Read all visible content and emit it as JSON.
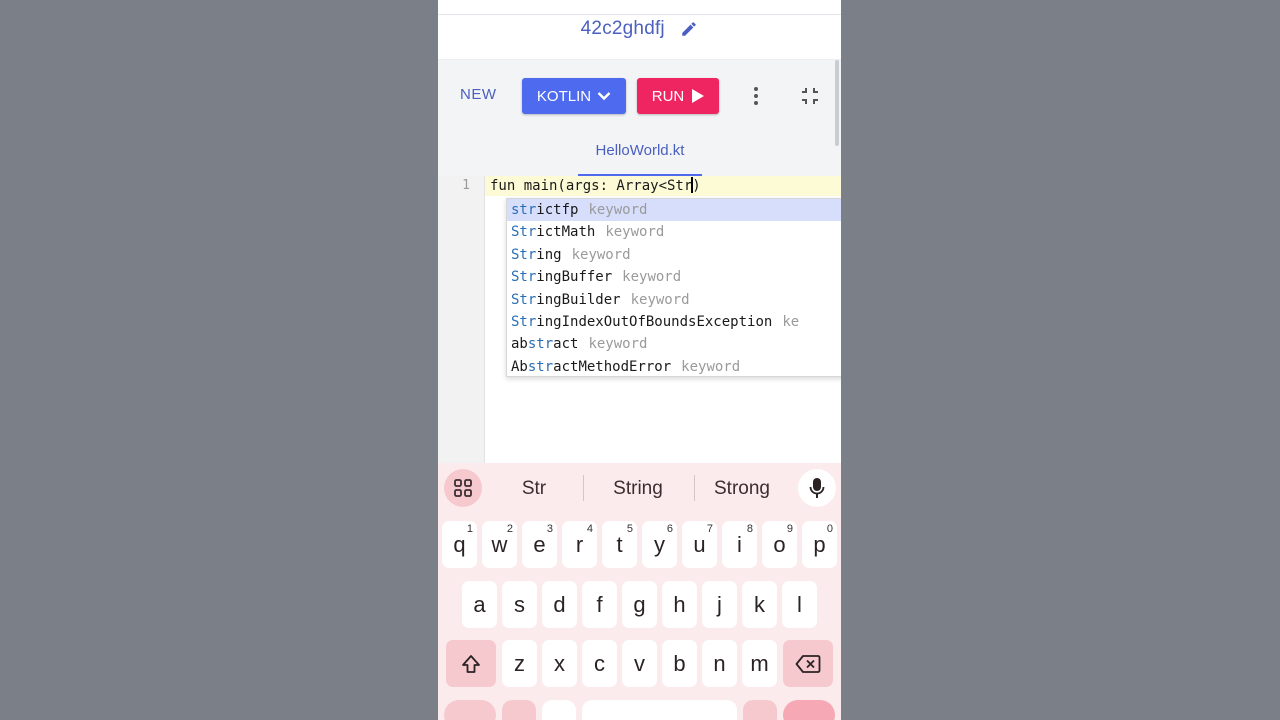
{
  "header": {
    "project_name": "42c2ghdfj"
  },
  "toolbar": {
    "new_label": "NEW",
    "language_label": "KOTLIN",
    "run_label": "RUN"
  },
  "tabs": [
    {
      "label": "HelloWorld.kt",
      "active": true
    }
  ],
  "editor": {
    "line_number": "1",
    "code_before_cursor": "fun main(args: Array<Str",
    "code_after_cursor": ")"
  },
  "completion": {
    "items": [
      {
        "match": "str",
        "rest": "ictfp",
        "prefix": "",
        "kind": "keyword",
        "selected": true
      },
      {
        "match": "Str",
        "rest": "ictMath",
        "prefix": "",
        "kind": "keyword"
      },
      {
        "match": "Str",
        "rest": "ing",
        "prefix": "",
        "kind": "keyword"
      },
      {
        "match": "Str",
        "rest": "ingBuffer",
        "prefix": "",
        "kind": "keyword"
      },
      {
        "match": "Str",
        "rest": "ingBuilder",
        "prefix": "",
        "kind": "keyword"
      },
      {
        "match": "Str",
        "rest": "ingIndexOutOfBoundsException",
        "prefix": "",
        "kind": "ke"
      },
      {
        "match": "str",
        "rest": "act",
        "prefix": "ab",
        "kind": "keyword"
      },
      {
        "match": "str",
        "rest": "actMethodError",
        "prefix": "Ab",
        "kind": "keyword"
      }
    ]
  },
  "keyboard": {
    "suggestions": [
      "Str",
      "String",
      "Strong"
    ],
    "row1": [
      {
        "key": "q",
        "num": "1"
      },
      {
        "key": "w",
        "num": "2"
      },
      {
        "key": "e",
        "num": "3"
      },
      {
        "key": "r",
        "num": "4"
      },
      {
        "key": "t",
        "num": "5"
      },
      {
        "key": "y",
        "num": "6"
      },
      {
        "key": "u",
        "num": "7"
      },
      {
        "key": "i",
        "num": "8"
      },
      {
        "key": "o",
        "num": "9"
      },
      {
        "key": "p",
        "num": "0"
      }
    ],
    "row2": [
      "a",
      "s",
      "d",
      "f",
      "g",
      "h",
      "j",
      "k",
      "l"
    ],
    "row3": [
      "z",
      "x",
      "c",
      "v",
      "b",
      "n",
      "m"
    ]
  },
  "colors": {
    "primary": "#4e6bf0",
    "run": "#ef2561",
    "keyboard_bg": "#fbebec"
  }
}
